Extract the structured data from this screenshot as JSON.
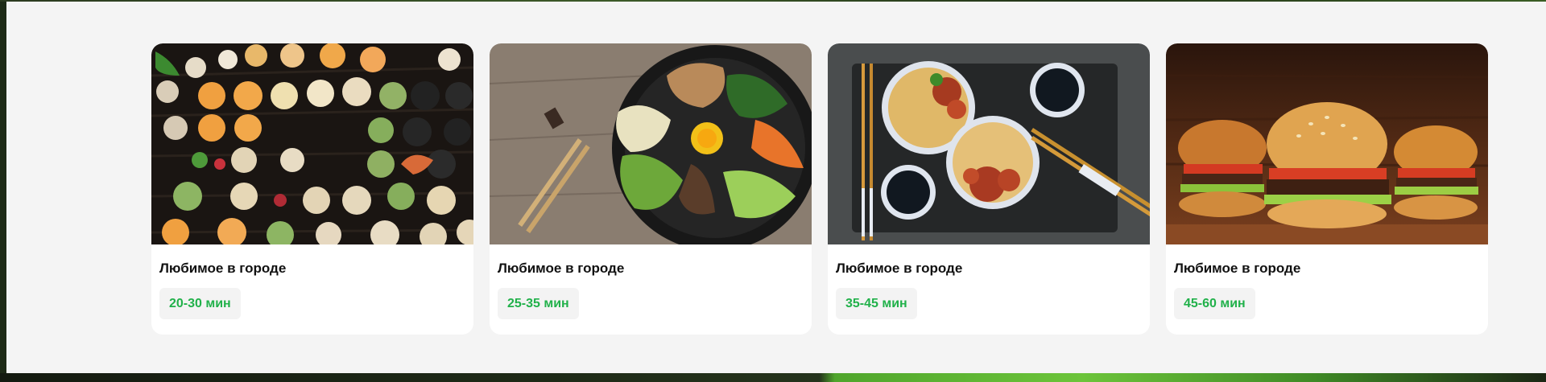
{
  "colors": {
    "section_bg": "#f4f4f4",
    "card_bg": "#ffffff",
    "badge_bg": "#f3f3f3",
    "accent_green": "#21b14a",
    "title_text": "#111111"
  },
  "cards": [
    {
      "image": "dumplings-photo",
      "title": "Любимое в городе",
      "delivery_time": "20-30 мин"
    },
    {
      "image": "bibimbap-photo",
      "title": "Любимое в городе",
      "delivery_time": "25-35 мин"
    },
    {
      "image": "noodles-photo",
      "title": "Любимое в городе",
      "delivery_time": "35-45 мин"
    },
    {
      "image": "burgers-photo",
      "title": "Любимое в городе",
      "delivery_time": "45-60 мин"
    }
  ]
}
